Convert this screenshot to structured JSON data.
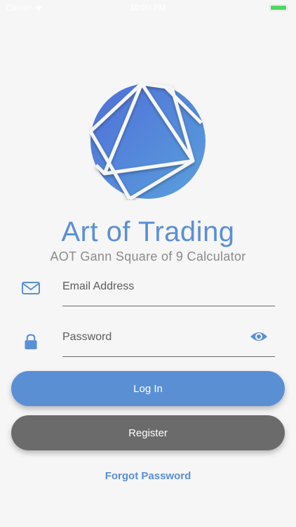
{
  "status_bar": {
    "carrier": "Carrier",
    "time": "10:00 PM"
  },
  "app": {
    "title": "Art of Trading",
    "subtitle": "AOT Gann Square of 9 Calculator"
  },
  "form": {
    "email": {
      "placeholder": "Email Address",
      "value": "",
      "icon": "envelope-icon"
    },
    "password": {
      "placeholder": "Password",
      "value": "",
      "icon": "lock-icon",
      "toggle_icon": "eye-icon"
    }
  },
  "buttons": {
    "login_label": "Log In",
    "register_label": "Register",
    "forgot_label": "Forgot Password"
  },
  "colors": {
    "accent": "#5a8fd4",
    "secondary_button": "#6b6b6b",
    "subtitle_text": "#8a8a8a",
    "background": "#f6f6f6"
  }
}
